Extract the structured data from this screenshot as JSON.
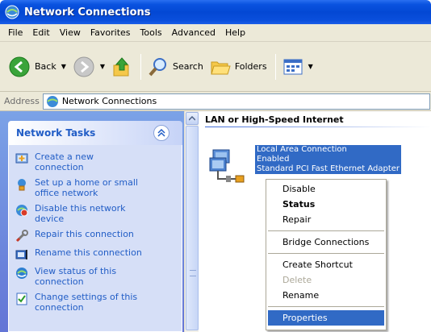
{
  "window": {
    "title": "Network Connections"
  },
  "menu": [
    "File",
    "Edit",
    "View",
    "Favorites",
    "Tools",
    "Advanced",
    "Help"
  ],
  "toolbar": {
    "back": "Back",
    "search": "Search",
    "folders": "Folders"
  },
  "address": {
    "label": "Address",
    "value": "Network Connections"
  },
  "tasks": {
    "title": "Network Tasks",
    "items": [
      {
        "label": "Create a new\nconnection",
        "icon": "new-connection-icon"
      },
      {
        "label": "Set up a home or small\noffice network",
        "icon": "home-network-icon"
      },
      {
        "label": "Disable this network\ndevice",
        "icon": "disable-device-icon"
      },
      {
        "label": "Repair this connection",
        "icon": "repair-icon"
      },
      {
        "label": "Rename this connection",
        "icon": "rename-icon"
      },
      {
        "label": "View status of this\nconnection",
        "icon": "status-icon"
      },
      {
        "label": "Change settings of this\nconnection",
        "icon": "settings-icon"
      }
    ]
  },
  "content": {
    "group": "LAN or High-Speed Internet",
    "connection": {
      "name": "Local Area Connection",
      "status": "Enabled",
      "device": "Standard PCI Fast Ethernet Adapter"
    }
  },
  "context_menu": {
    "disable": "Disable",
    "status": "Status",
    "repair": "Repair",
    "bridge": "Bridge Connections",
    "shortcut": "Create Shortcut",
    "delete": "Delete",
    "rename": "Rename",
    "properties": "Properties"
  }
}
